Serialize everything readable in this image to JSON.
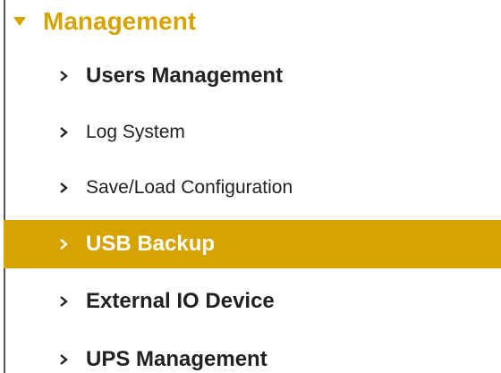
{
  "colors": {
    "accent": "#d6a300",
    "text": "#222222",
    "active_text": "#ffffff",
    "border": "#555555"
  },
  "section": {
    "title": "Management",
    "icon": "triangle-down-icon",
    "expanded": true
  },
  "items": [
    {
      "label": "Users Management",
      "icon": "chevron-right-icon",
      "active": false
    },
    {
      "label": "Log System",
      "icon": "chevron-right-icon",
      "active": false
    },
    {
      "label": "Save/Load Configuration",
      "icon": "chevron-right-icon",
      "active": false
    },
    {
      "label": "USB Backup",
      "icon": "chevron-right-icon",
      "active": true
    },
    {
      "label": "External IO Device",
      "icon": "chevron-right-icon",
      "active": false
    },
    {
      "label": "UPS Management",
      "icon": "chevron-right-icon",
      "active": false
    }
  ]
}
